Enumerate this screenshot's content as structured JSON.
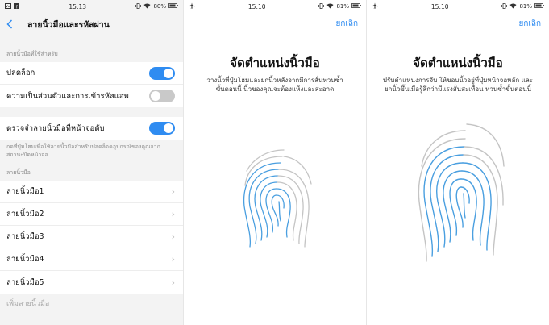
{
  "panel1": {
    "status": {
      "time": "15:13",
      "battery": "80%"
    },
    "title": "ลายนิ้วมือและรหัสผ่าน",
    "section1_label": "ลายนิ้วมือที่ใช้สำหรับ",
    "unlock_label": "ปลดล็อก",
    "privacy_label": "ความเป็นส่วนตัวและการเข้ารหัสแอพ",
    "screen_off_label": "ตรวจจำลายนิ้วมือที่หน้าจอดับ",
    "screen_off_desc": "กดที่ปุ่มโฮมเพื่อใช้ลายนิ้วมือสำหรับปลดล็อคอุปกรณ์ของคุณจากสถานะปิดหน้าจอ",
    "section2_label": "ลายนิ้วมือ",
    "fingerprints": [
      "ลายนิ้วมือ1",
      "ลายนิ้วมือ2",
      "ลายนิ้วมือ3",
      "ลายนิ้วมือ4",
      "ลายนิ้วมือ5"
    ],
    "add_label": "เพิ่มลายนิ้วมือ"
  },
  "panel2": {
    "status": {
      "time": "15:10",
      "battery": "81%"
    },
    "cancel_label": "ยกเลิก",
    "heading": "จัดตำแหน่งนิ้วมือ",
    "instruction": "วางนิ้วที่ปุ่มโฮมและยกนิ้วหลังจากมีการสั่นทวนซ้ำขั้นตอนนี้ นิ้วของคุณจะต้องแห้งและสะอาด"
  },
  "panel3": {
    "status": {
      "time": "15:10",
      "battery": "81%"
    },
    "cancel_label": "ยกเลิก",
    "heading": "จัดตำแหน่งนิ้วมือ",
    "instruction": "ปรับตำแหน่งการจับ ให้ขอบนิ้วอยู่ที่ปุ่มหน้าจอหลัก และยกนิ้วขึ้นเมื่อรู้สึกว่ามีแรงสั่นสะเทือน ทวนซ้ำขั้นตอนนี้"
  },
  "colors": {
    "accent": "#2f8cf1",
    "fingerprint_blue": "#4a9fe0",
    "fingerprint_gray": "#c4c4c4"
  }
}
